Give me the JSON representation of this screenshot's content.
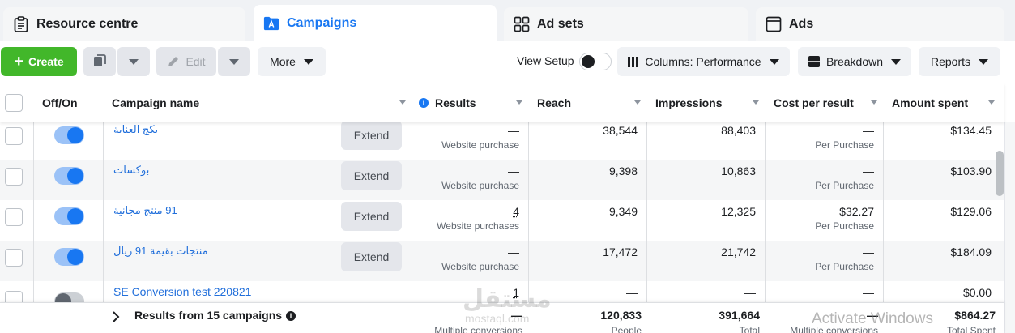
{
  "tabs": [
    {
      "label": "Resource centre",
      "icon": "clipboard-icon",
      "active": false
    },
    {
      "label": "Campaigns",
      "icon": "campaign-folder-icon",
      "active": true
    },
    {
      "label": "Ad sets",
      "icon": "grid-icon",
      "active": false
    },
    {
      "label": "Ads",
      "icon": "ad-frame-icon",
      "active": false
    }
  ],
  "toolbar": {
    "create_label": "Create",
    "edit_label": "Edit",
    "more_label": "More",
    "view_setup_label": "View Setup",
    "columns_label": "Columns: Performance",
    "breakdown_label": "Breakdown",
    "reports_label": "Reports"
  },
  "table": {
    "headers": {
      "off_on": "Off/On",
      "campaign_name": "Campaign name",
      "results": "Results",
      "reach": "Reach",
      "impressions": "Impressions",
      "cost_per_result": "Cost per result",
      "amount_spent": "Amount spent"
    },
    "extend_label": "Extend",
    "rows": [
      {
        "name": "بكج العناية",
        "on": true,
        "extend": true,
        "results": "—",
        "results_sub": "Website purchase",
        "reach": "38,544",
        "impressions": "88,403",
        "cost": "—",
        "cost_sub": "Per Purchase",
        "spent": "$134.45"
      },
      {
        "name": "بوكسات",
        "on": true,
        "extend": true,
        "results": "—",
        "results_sub": "Website purchase",
        "reach": "9,398",
        "impressions": "10,863",
        "cost": "—",
        "cost_sub": "Per Purchase",
        "spent": "$103.90"
      },
      {
        "name": "91 منتج مجانية",
        "on": true,
        "extend": true,
        "results": "4",
        "results_sub": "Website purchases",
        "reach": "9,349",
        "impressions": "12,325",
        "cost": "$32.27",
        "cost_sub": "Per Purchase",
        "spent": "$129.06"
      },
      {
        "name": "منتجات بقيمة 91 ريال",
        "on": true,
        "extend": true,
        "results": "—",
        "results_sub": "Website purchase",
        "reach": "17,472",
        "impressions": "21,742",
        "cost": "—",
        "cost_sub": "Per Purchase",
        "spent": "$184.09"
      },
      {
        "name": "SE Conversion test 220821",
        "on": false,
        "extend": false,
        "results": "1",
        "results_sub": "",
        "reach": "—",
        "impressions": "—",
        "cost": "—",
        "cost_sub": "",
        "spent": "$0.00"
      }
    ],
    "totals": {
      "label": "Results from 15 campaigns",
      "results": "—",
      "results_sub": "Multiple conversions",
      "reach": "120,833",
      "reach_sub": "People",
      "impressions": "391,664",
      "impressions_sub": "Total",
      "cost": "—",
      "cost_sub": "Multiple conversions",
      "spent": "$864.27",
      "spent_sub": "Total Spent"
    }
  },
  "watermark": {
    "arabic": "مستقل",
    "latin": "mostaql.com"
  },
  "os_overlay": "Activate Windows",
  "colors": {
    "accent": "#1877f2",
    "create": "#42b72a",
    "link": "#216fdb"
  }
}
